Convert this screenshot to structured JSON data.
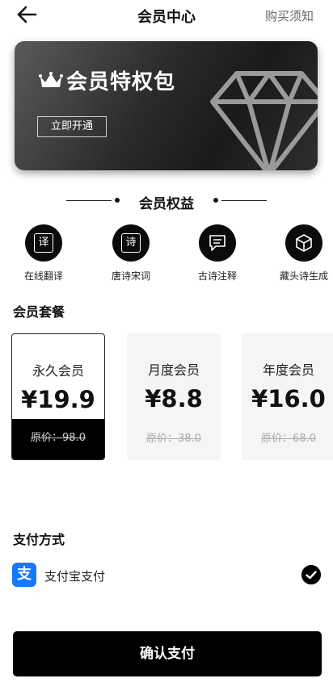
{
  "header": {
    "title": "会员中心",
    "notice_label": "购买须知"
  },
  "banner": {
    "title": "会员特权包",
    "open_button": "立即开通"
  },
  "benefits": {
    "title": "会员权益",
    "items": [
      {
        "icon_char": "译",
        "label": "在线翻译",
        "icon": "translate-icon"
      },
      {
        "icon_char": "诗",
        "label": "唐诗宋词",
        "icon": "poem-icon"
      },
      {
        "icon_char": "",
        "label": "古诗注释",
        "icon": "comment-icon"
      },
      {
        "icon_char": "",
        "label": "藏头诗生成",
        "icon": "cube-icon"
      }
    ]
  },
  "packages": {
    "title": "会员套餐",
    "items": [
      {
        "name": "永久会员",
        "price": "¥19.9",
        "original": "原价：98.0",
        "selected": true
      },
      {
        "name": "月度会员",
        "price": "¥8.8",
        "original": "原价：38.0",
        "selected": false
      },
      {
        "name": "年度会员",
        "price": "¥16.0",
        "original": "原价：68.0",
        "selected": false
      }
    ]
  },
  "payment": {
    "title": "支付方式",
    "method": {
      "icon_char": "支",
      "label": "支付宝支付",
      "checked": true
    }
  },
  "confirm_button": "确认支付",
  "colors": {
    "primary": "#000000",
    "alipay": "#1678ff",
    "card_bg": "#f5f5f5"
  }
}
